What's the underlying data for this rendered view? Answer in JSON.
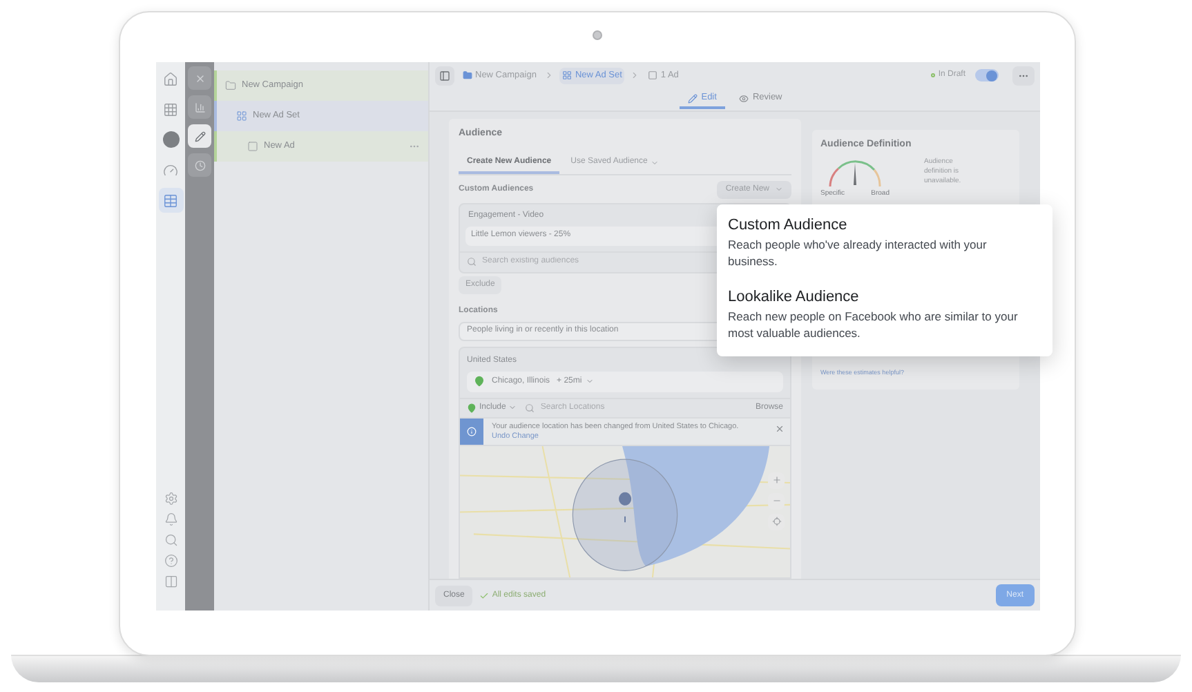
{
  "nav_rail": {
    "items": [
      {
        "kind": "home",
        "selected": false
      },
      {
        "kind": "apps",
        "selected": false
      },
      {
        "kind": "account",
        "selected": false
      },
      {
        "kind": "gauge",
        "selected": false
      },
      {
        "kind": "table",
        "selected": true
      }
    ],
    "bottom_items": [
      {
        "kind": "settings"
      },
      {
        "kind": "bell"
      },
      {
        "kind": "search"
      },
      {
        "kind": "help"
      },
      {
        "kind": "panel"
      }
    ]
  },
  "tool_rail": {
    "items": [
      {
        "kind": "close",
        "selected": false
      },
      {
        "kind": "chart",
        "selected": false
      },
      {
        "kind": "edit",
        "selected": true
      },
      {
        "kind": "clock",
        "selected": false
      }
    ]
  },
  "tree": [
    {
      "label": "New Campaign",
      "kind": "campaign",
      "selected": false,
      "children": [
        {
          "label": "New Ad Set",
          "kind": "adset",
          "selected": true,
          "children": [
            {
              "label": "New Ad",
              "kind": "ad",
              "selected": false
            }
          ]
        }
      ]
    }
  ],
  "breadcrumbs": [
    {
      "label": "New Campaign",
      "kind": "campaign",
      "selected": false
    },
    {
      "label": "New Ad Set",
      "kind": "adset",
      "selected": true
    },
    {
      "label": "1 Ad",
      "kind": "ad",
      "selected": false
    }
  ],
  "status": {
    "label": "In Draft",
    "on": true
  },
  "view_tabs": [
    {
      "label": "Edit",
      "kind": "edit",
      "selected": true
    },
    {
      "label": "Review",
      "kind": "review",
      "selected": false
    }
  ],
  "audience": {
    "title": "Audience",
    "tabs": [
      {
        "label": "Create New Audience",
        "selected": true
      },
      {
        "label": "Use Saved Audience",
        "selected": false
      }
    ],
    "custom_audiences": {
      "label": "Custom Audiences",
      "create_button": "Create New",
      "group": "Engagement - Video",
      "item": "Little Lemon viewers - 25%",
      "search": {
        "placeholder": "Search existing audiences"
      },
      "exclude_button": "Exclude"
    },
    "locations": {
      "label": "Locations",
      "type_select": "People living in or recently in this location",
      "country": "United States",
      "location": "Chicago, Illinois",
      "radius": "+ 25mi",
      "include": "Include",
      "search": {
        "placeholder": "Search Locations"
      },
      "browse": "Browse",
      "notice": "Your audience location has been changed from United States to Chicago.",
      "undo_link": "Undo Change"
    }
  },
  "definition": {
    "title": "Audience Definition",
    "gauge_low": "Specific",
    "gauge_high": "Broad",
    "note": "Audience definition is unavailable.",
    "feedback_link": "Were these estimates helpful?"
  },
  "popup": {
    "options": [
      {
        "title": "Custom Audience",
        "description": "Reach people who've already interacted with your business."
      },
      {
        "title": "Lookalike Audience",
        "description": "Reach new people on Facebook who are similar to your most valuable audiences."
      }
    ]
  },
  "footer": {
    "close_button": "Close",
    "save_status": "All edits saved",
    "next_button": "Next"
  }
}
